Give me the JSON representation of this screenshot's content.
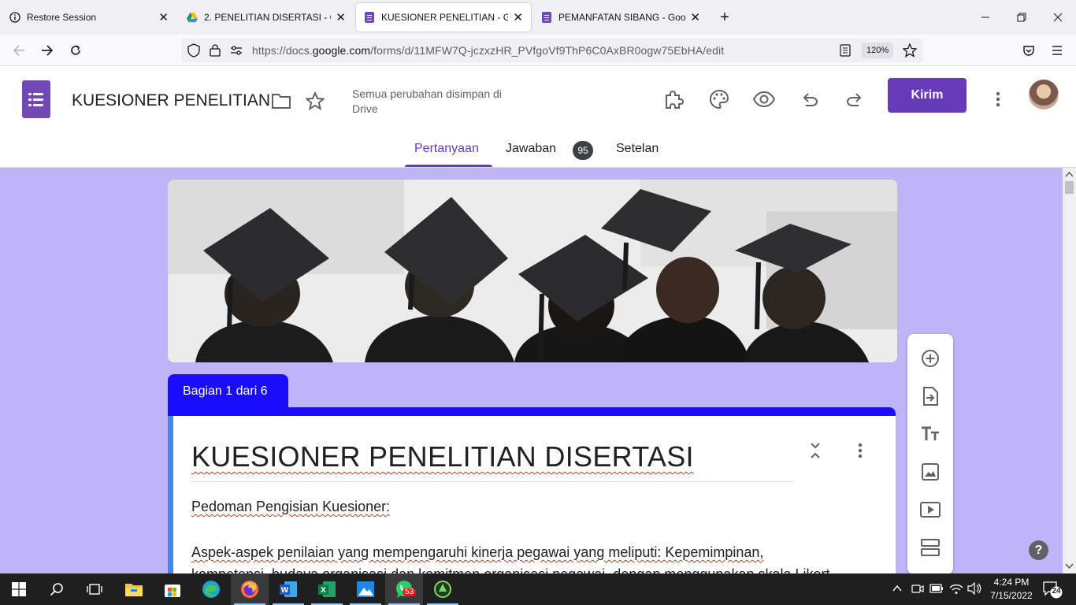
{
  "browser": {
    "tabs": [
      {
        "label": "Restore Session",
        "icon": "info-icon"
      },
      {
        "label": "2. PENELITIAN DISERTASI - Goog",
        "icon": "google-drive-icon"
      },
      {
        "label": "KUESIONER PENELITIAN - Goog",
        "icon": "google-forms-icon",
        "active": true
      },
      {
        "label": "PEMANFATAN SIBANG - Google",
        "icon": "google-forms-icon"
      }
    ],
    "url_prefix": "https://docs.",
    "url_domain": "google.com",
    "url_path": "/forms/d/11MFW7Q-jczxzHR_PVfgoVf9ThP6C0AxBR0ogw75EbHA/edit",
    "zoom": "120%"
  },
  "form": {
    "title": "KUESIONER PENELITIAN",
    "save_status": "Semua perubahan disimpan di Drive",
    "send_label": "Kirim",
    "tabs": {
      "questions": "Pertanyaan",
      "responses": "Jawaban",
      "responses_count": "95",
      "settings": "Setelan"
    },
    "section_label": "Bagian 1 dari 6",
    "section_title": "KUESIONER PENELITIAN DISERTASI",
    "description_line1": "Pedoman Pengisian Kuesioner:",
    "description_line2": "Aspek-aspek penilaian yang mempengaruhi kinerja pegawai yang meliputi: Kepemimpinan,",
    "description_line3": "kompetensi, budaya organisasi dan komitmen organisasi pegawai, dengan menggunakan skala Likert"
  },
  "taskbar": {
    "time": "4:24 PM",
    "date": "7/15/2022",
    "whatsapp_badge": "53",
    "notifications": "24"
  },
  "colors": {
    "form_purple": "#673ab7",
    "theme_bg": "#bfb4f8",
    "section_blue": "#1a0dff",
    "active_card_accent": "#4285f4"
  }
}
